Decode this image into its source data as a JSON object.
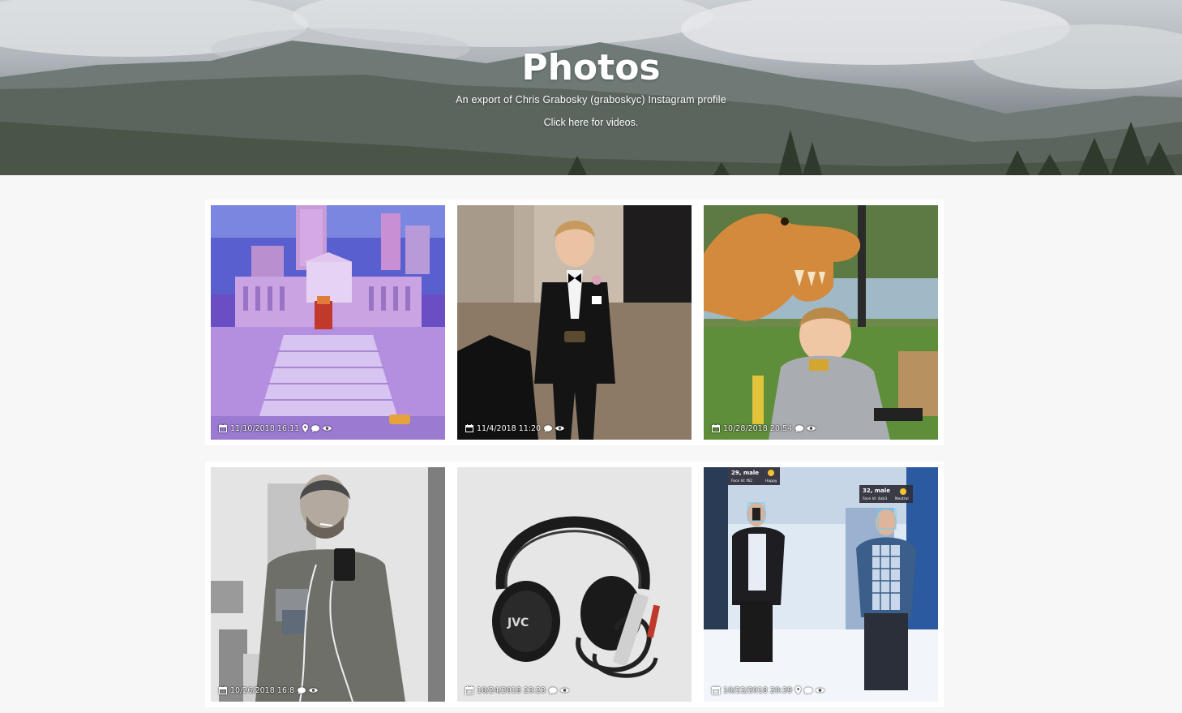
{
  "header": {
    "title": "Photos",
    "subtitle": "An export of Chris Grabosky (graboskyc) Instagram profile",
    "videos_link": "Click here for videos."
  },
  "photos": [
    {
      "date": "11/10/2018 16:11",
      "icons": [
        "calendar-icon",
        "location-pin-icon",
        "comment-icon",
        "eye-icon"
      ],
      "subject": "lego-city-scene"
    },
    {
      "date": "11/4/2018 11:20",
      "icons": [
        "calendar-icon",
        "comment-icon",
        "eye-icon"
      ],
      "subject": "boy-in-tuxedo"
    },
    {
      "date": "10/28/2018 20:54",
      "icons": [
        "calendar-icon",
        "comment-icon",
        "eye-icon"
      ],
      "subject": "boy-with-toy-dinosaur"
    },
    {
      "date": "10/26/2018 16:8",
      "icons": [
        "calendar-icon",
        "comment-icon",
        "eye-icon"
      ],
      "subject": "man-mirror-selfie"
    },
    {
      "date": "10/24/2018 23:23",
      "icons": [
        "calendar-icon",
        "comment-icon",
        "eye-icon"
      ],
      "subject": "jvc-headphones"
    },
    {
      "date": "10/22/2018 20:39",
      "icons": [
        "calendar-icon",
        "location-pin-icon",
        "comment-icon",
        "eye-icon"
      ],
      "subject": "face-detection-selfie"
    }
  ],
  "face_tags": [
    {
      "line1": "29, male",
      "line2": "Face Id: f62",
      "mood": "Happy"
    },
    {
      "line1": "32, male",
      "line2": "Face Id: 4ab3",
      "mood": "Neutral"
    }
  ],
  "headphone_brand": "JVC",
  "colors": {
    "background": "#f7f7f7",
    "card": "#ffffff",
    "hero_text": "#ffffff"
  }
}
